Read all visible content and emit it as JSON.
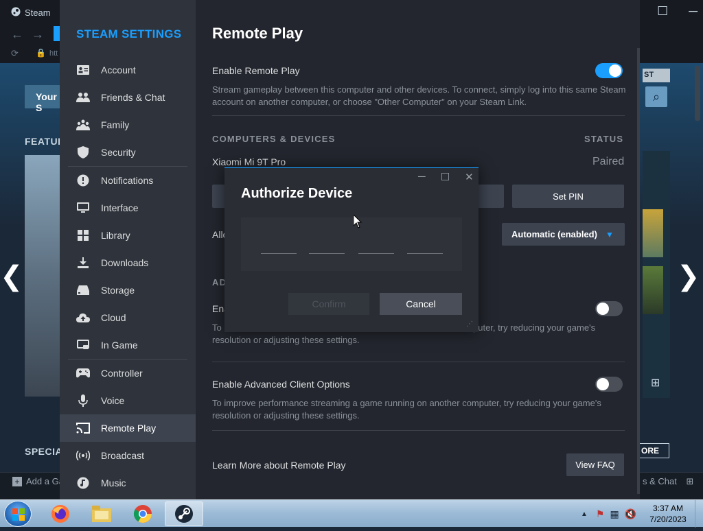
{
  "background": {
    "app_title": "Steam",
    "store_tab_partial": "Your S",
    "featured_partial": "FEATUR",
    "special_partial": "SPECIAL",
    "add_game_partial": "Add a Ga",
    "right_button_partial": "ST",
    "more_partial": "ORE",
    "chat_partial": "s & Chat",
    "url_partial": "htt",
    "nav_left_glyph": "❮",
    "nav_right_glyph": "❯"
  },
  "sidebar": {
    "title": "STEAM SETTINGS",
    "items": [
      {
        "label": "Account",
        "icon": "account-icon"
      },
      {
        "label": "Friends & Chat",
        "icon": "friends-icon"
      },
      {
        "label": "Family",
        "icon": "family-icon"
      },
      {
        "label": "Security",
        "icon": "shield-icon"
      },
      {
        "label": "Notifications",
        "icon": "notifications-icon"
      },
      {
        "label": "Interface",
        "icon": "monitor-icon"
      },
      {
        "label": "Library",
        "icon": "library-grid-icon"
      },
      {
        "label": "Downloads",
        "icon": "download-icon"
      },
      {
        "label": "Storage",
        "icon": "storage-drive-icon"
      },
      {
        "label": "Cloud",
        "icon": "cloud-icon"
      },
      {
        "label": "In Game",
        "icon": "in-game-icon"
      },
      {
        "label": "Controller",
        "icon": "gamepad-icon"
      },
      {
        "label": "Voice",
        "icon": "microphone-icon"
      },
      {
        "label": "Remote Play",
        "icon": "cast-icon"
      },
      {
        "label": "Broadcast",
        "icon": "broadcast-icon"
      },
      {
        "label": "Music",
        "icon": "music-icon"
      }
    ],
    "active_item": "Remote Play"
  },
  "content": {
    "title": "Remote Play",
    "enable_remote_play": {
      "label": "Enable Remote Play",
      "enabled": true,
      "description": "Stream gameplay between this computer and other devices. To connect, simply log into this same Steam account on another computer, or choose \"Other Computer\" on your Steam Link."
    },
    "devices_header": "COMPUTERS & DEVICES",
    "status_header": "STATUS",
    "device_name": "Xiaomi Mi 9T Pro",
    "device_status": "Paired",
    "set_pin_label": "Set PIN",
    "allow_partial": "Allo",
    "allow_value": "Automatic (enabled)",
    "advanced_partial": "AD",
    "host_partial": "Ena",
    "host_desc_partial_1": "To",
    "host_desc_tail_1": "puter, try reducing your game's",
    "host_desc_line_2": "resolution or adjusting these settings.",
    "host_enabled": false,
    "advanced_client": {
      "label": "Enable Advanced Client Options",
      "enabled": false,
      "description": "To improve performance streaming a game running on another computer, try reducing your game's resolution or adjusting these settings."
    },
    "learn_more_label": "Learn More about Remote Play",
    "view_faq_label": "View FAQ"
  },
  "dialog": {
    "title": "Authorize Device",
    "confirm_label": "Confirm",
    "cancel_label": "Cancel",
    "pin_slots": 4
  },
  "taskbar": {
    "time": "3:37 AM",
    "date": "7/20/2023",
    "apps": [
      "firefox-icon",
      "file-explorer-icon",
      "chrome-icon",
      "steam-icon"
    ]
  },
  "colors": {
    "accent": "#1a9fff",
    "sidebar_bg": "#2f333b",
    "content_bg": "#23262e",
    "dialog_bg": "#2a2d34"
  }
}
